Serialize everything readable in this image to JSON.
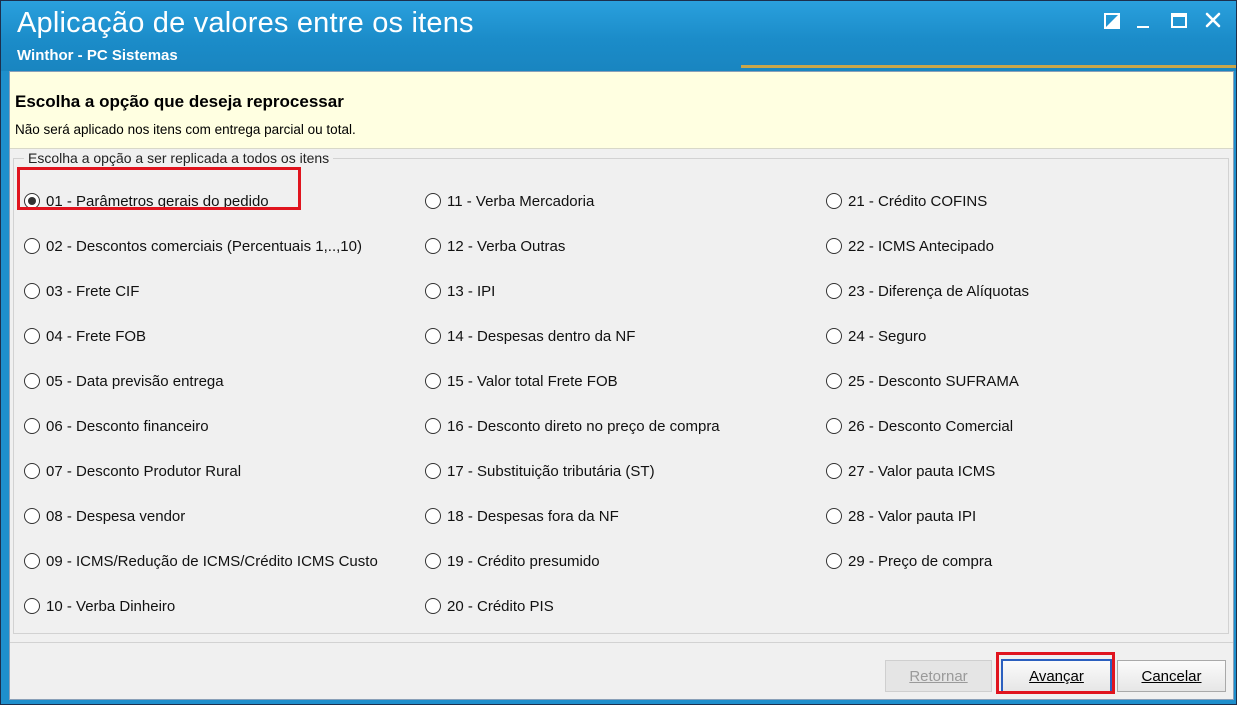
{
  "window": {
    "title": "Aplicação de valores entre os itens",
    "subtitle": "Winthor - PC Sistemas"
  },
  "header": {
    "title": "Escolha a opção que deseja reprocessar",
    "subtitle": "Não será aplicado nos itens com entrega parcial ou total."
  },
  "group": {
    "legend": "Escolha a opção a ser replicada a todos os itens"
  },
  "options": [
    {
      "label": "01 - Parâmetros gerais do pedido",
      "checked": true
    },
    {
      "label": "02 - Descontos comerciais (Percentuais 1,..,10)",
      "checked": false
    },
    {
      "label": "03 - Frete CIF",
      "checked": false
    },
    {
      "label": "04 - Frete FOB",
      "checked": false
    },
    {
      "label": "05 - Data previsão entrega",
      "checked": false
    },
    {
      "label": "06 - Desconto financeiro",
      "checked": false
    },
    {
      "label": "07 - Desconto Produtor Rural",
      "checked": false
    },
    {
      "label": "08 - Despesa vendor",
      "checked": false
    },
    {
      "label": "09 - ICMS/Redução de ICMS/Crédito ICMS Custo",
      "checked": false
    },
    {
      "label": "10 - Verba Dinheiro",
      "checked": false
    },
    {
      "label": "11 - Verba Mercadoria",
      "checked": false
    },
    {
      "label": "12 - Verba Outras",
      "checked": false
    },
    {
      "label": "13 - IPI",
      "checked": false
    },
    {
      "label": "14 - Despesas dentro da NF",
      "checked": false
    },
    {
      "label": "15 - Valor total Frete FOB",
      "checked": false
    },
    {
      "label": "16 - Desconto direto no preço de compra",
      "checked": false
    },
    {
      "label": "17 - Substituição tributária (ST)",
      "checked": false
    },
    {
      "label": "18 - Despesas fora da NF",
      "checked": false
    },
    {
      "label": "19 - Crédito presumido",
      "checked": false
    },
    {
      "label": "20 - Crédito PIS",
      "checked": false
    },
    {
      "label": "21 - Crédito COFINS",
      "checked": false
    },
    {
      "label": "22 - ICMS Antecipado",
      "checked": false
    },
    {
      "label": "23 - Diferença de Alíquotas",
      "checked": false
    },
    {
      "label": "24 - Seguro",
      "checked": false
    },
    {
      "label": "25 - Desconto SUFRAMA",
      "checked": false
    },
    {
      "label": "26 - Desconto Comercial",
      "checked": false
    },
    {
      "label": "27 - Valor pauta ICMS",
      "checked": false
    },
    {
      "label": "28 - Valor pauta IPI",
      "checked": false
    },
    {
      "label": "29 - Preço de compra",
      "checked": false
    }
  ],
  "buttons": {
    "back": "Retornar",
    "next": "Avançar",
    "cancel": "Cancelar"
  },
  "icons": {
    "restore": "restore-icon",
    "minimize": "minimize-icon",
    "maximize": "maximize-icon",
    "close": "close-icon"
  },
  "colors": {
    "titlebar": "#1b8cc9",
    "header_panel": "#ffffe1",
    "highlight": "#e0141e"
  }
}
